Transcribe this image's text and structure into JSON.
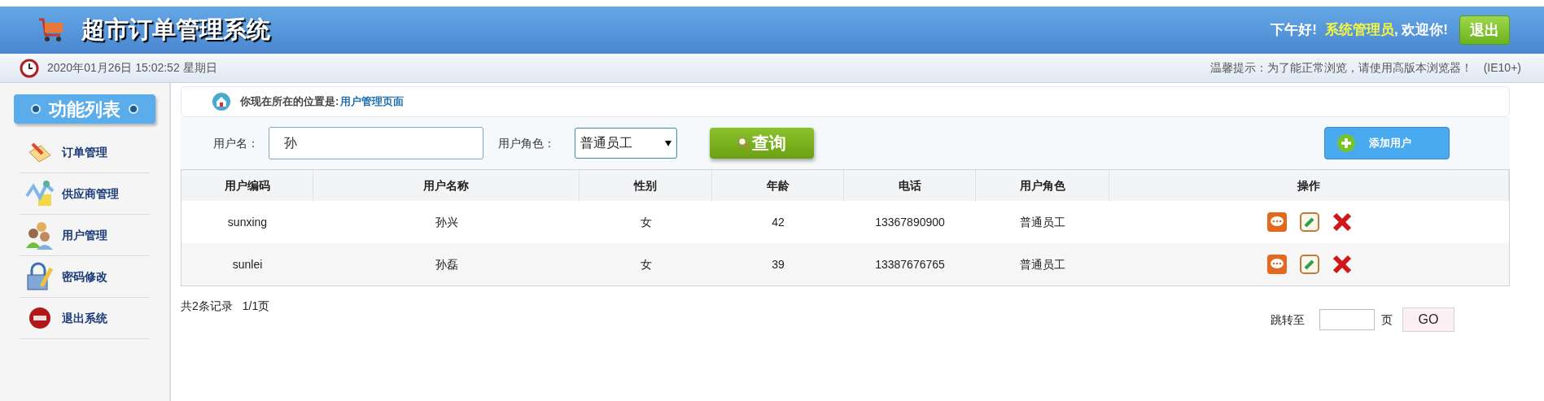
{
  "header": {
    "title": "超市订单管理系统",
    "greeting": "下午好!",
    "user": "系统管理员",
    "welcome": ", 欢迎你!",
    "logout": "退出"
  },
  "status_bar": {
    "datetime": "2020年01月26日 15:02:52 星期日",
    "tip": "温馨提示：为了能正常浏览，请使用高版本浏览器！",
    "browser": "(IE10+)"
  },
  "sidebar": {
    "title": "功能列表",
    "items": [
      {
        "label": "订单管理",
        "kind": "order"
      },
      {
        "label": "供应商管理",
        "kind": "supplier"
      },
      {
        "label": "用户管理",
        "kind": "user"
      },
      {
        "label": "密码修改",
        "kind": "password"
      },
      {
        "label": "退出系统",
        "kind": "exit"
      }
    ]
  },
  "breadcrumb": {
    "prefix": "你现在所在的位置是:",
    "page": "用户管理页面"
  },
  "search": {
    "name_label": "用户名：",
    "name_value": "孙",
    "role_label": "用户角色：",
    "role_value": "普通员工",
    "query": "查询",
    "add": "添加用户"
  },
  "table": {
    "columns": [
      "用户编码",
      "用户名称",
      "性别",
      "年龄",
      "电话",
      "用户角色",
      "操作"
    ],
    "rows": [
      {
        "code": "sunxing",
        "name": "孙兴",
        "gender": "女",
        "age": "42",
        "phone": "13367890900",
        "role": "普通员工"
      },
      {
        "code": "sunlei",
        "name": "孙磊",
        "gender": "女",
        "age": "39",
        "phone": "13387676765",
        "role": "普通员工"
      }
    ]
  },
  "pagination": {
    "total": "共2条记录",
    "pages": "1/1页",
    "jump_label": "跳转至",
    "page_unit": "页",
    "go": "GO"
  }
}
